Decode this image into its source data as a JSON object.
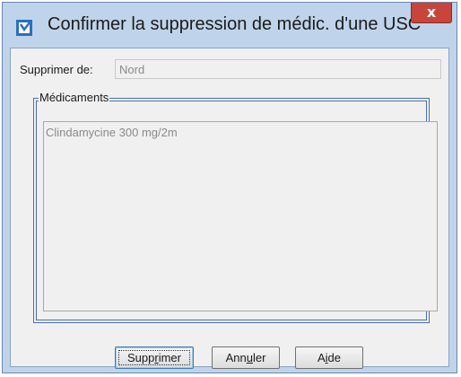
{
  "window": {
    "title": "Confirmer la suppression de médic. d'une USC",
    "close_glyph": "x"
  },
  "form": {
    "from_label": "Supprimer de:",
    "from_value": "Nord"
  },
  "medications": {
    "legend": "Médicaments",
    "items": [
      "Clindamycine 300 mg/2m"
    ]
  },
  "buttons": {
    "delete": {
      "pre": "Supp",
      "mnemonic": "r",
      "post": "imer"
    },
    "cancel": {
      "pre": "Ann",
      "mnemonic": "u",
      "post": "ler"
    },
    "help": {
      "pre": "A",
      "mnemonic": "i",
      "post": "de"
    }
  },
  "icons": {
    "app": "checkbox-app-icon",
    "close": "close-icon"
  },
  "colors": {
    "window_frame": "#bfd4ea",
    "close_button": "#c7453a",
    "groupbox_border": "#4a6fb0"
  }
}
